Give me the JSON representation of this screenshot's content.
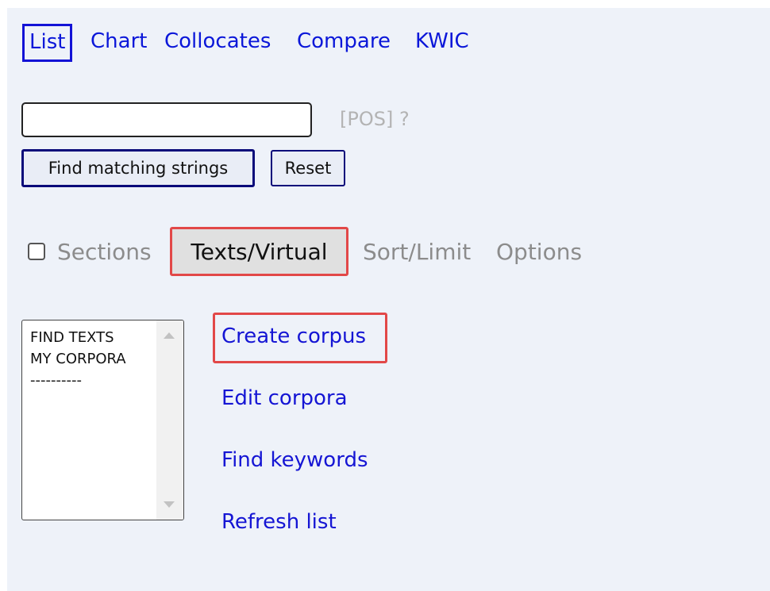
{
  "nav": {
    "tabs": [
      {
        "label": "List",
        "active": true
      },
      {
        "label": "Chart"
      },
      {
        "label": "Collocates"
      },
      {
        "label": "Compare"
      },
      {
        "label": "KWIC"
      }
    ]
  },
  "search": {
    "value": "",
    "placeholder": "",
    "pos_hint": "[POS] ?"
  },
  "buttons": {
    "find_label": "Find matching strings",
    "reset_label": "Reset"
  },
  "options_tabs": {
    "sections_label": "Sections",
    "sections_checked": false,
    "texts_virtual_label": "Texts/Virtual",
    "sort_limit_label": "Sort/Limit",
    "options_label": "Options"
  },
  "corpus_list": {
    "items": [
      "FIND TEXTS",
      "MY CORPORA",
      "----------"
    ]
  },
  "actions": {
    "create_corpus": "Create corpus",
    "edit_corpora": "Edit corpora",
    "find_keywords": "Find keywords",
    "refresh_list": "Refresh list"
  },
  "colors": {
    "panel_background": "#eef2f9",
    "link_blue": "#1515d4",
    "highlight_red": "#e24848",
    "muted_gray": "#8c8c8c"
  }
}
